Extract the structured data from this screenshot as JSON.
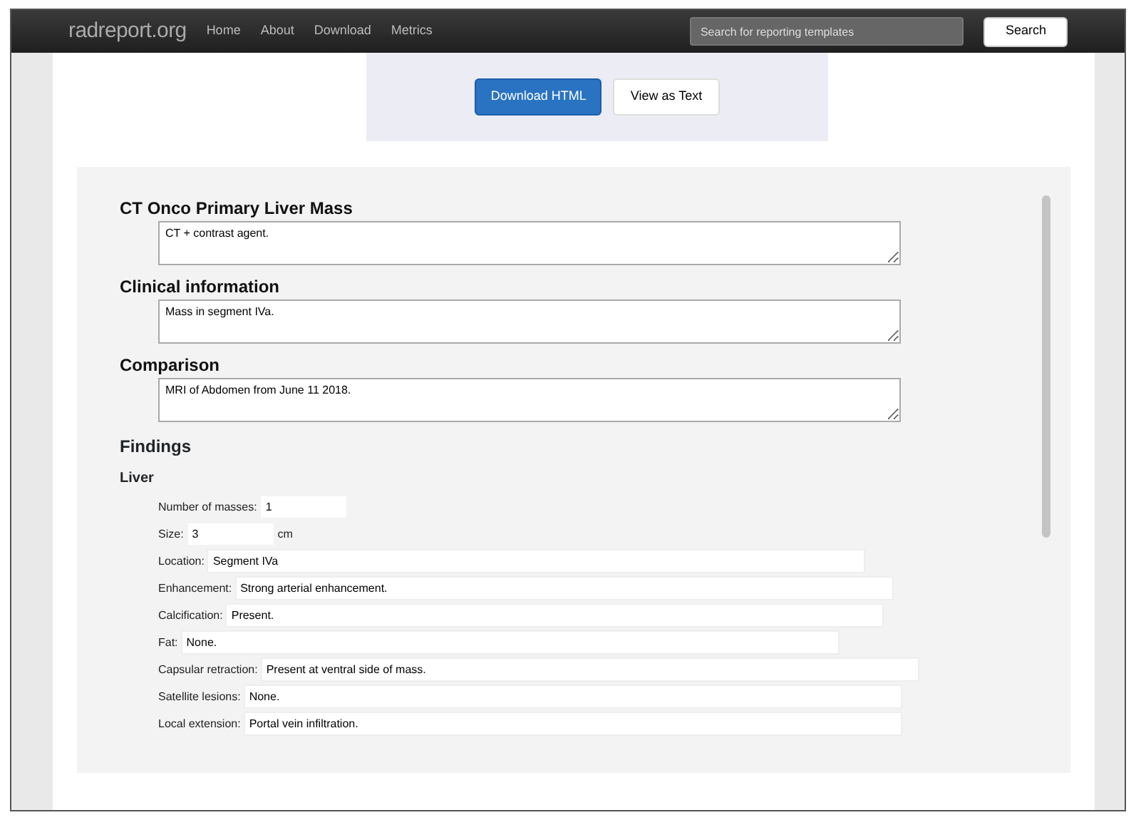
{
  "navbar": {
    "brand": "radreport.org",
    "links": [
      "Home",
      "About",
      "Download",
      "Metrics"
    ],
    "search": {
      "placeholder": "Search for reporting templates"
    },
    "search_button": "Search"
  },
  "actions": [
    "Download HTML",
    "View as Text"
  ],
  "sections": [
    {
      "title": "CT Onco Primary Liver Mass",
      "value": "CT + contrast agent."
    },
    {
      "title": "Clinical information",
      "value": "Mass in segment IVa."
    },
    {
      "title": "Comparison",
      "value": "MRI of Abdomen from June 11 2018."
    }
  ],
  "findings": {
    "title": "Findings",
    "subtitle": "Liver",
    "fields": [
      {
        "kind": "spin",
        "label": "Number of masses:",
        "value": "1"
      },
      {
        "kind": "spin",
        "label": "Size:",
        "value": "3",
        "unit": "cm"
      },
      {
        "kind": "text",
        "label": "Location:",
        "value": "Segment IVa"
      },
      {
        "kind": "text",
        "label": "Enhancement:",
        "value": "Strong arterial enhancement."
      },
      {
        "kind": "text",
        "label": "Calcification:",
        "value": "Present."
      },
      {
        "kind": "text",
        "label": "Fat:",
        "value": "None."
      },
      {
        "kind": "text",
        "label": "Capsular retraction:",
        "value": "Present at ventral side of mass."
      },
      {
        "kind": "text",
        "label": "Satellite lesions:",
        "value": "None."
      },
      {
        "kind": "text",
        "label": "Local extension:",
        "value": "Portal vein infiltration."
      }
    ]
  }
}
